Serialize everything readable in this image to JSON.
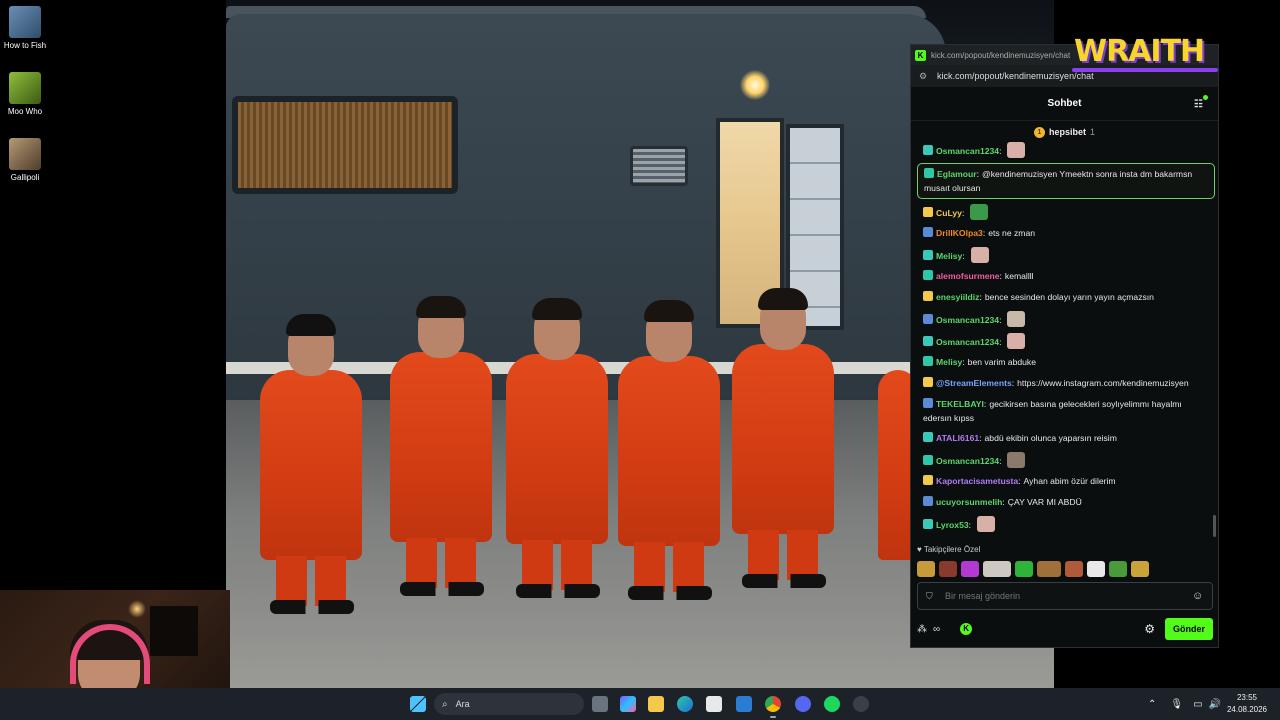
{
  "desktop": {
    "icons": [
      {
        "label": "How to Fish",
        "color": "#6a8fb5"
      },
      {
        "label": "Moo Who",
        "color": "#5a7d2a"
      },
      {
        "label": "Gallipoli",
        "color": "#8a7458"
      }
    ]
  },
  "browser": {
    "title_url": "kick.com/popout/kendinemuzisyen/chat",
    "address_url": "kick.com/popout/kendinemuzisyen/chat"
  },
  "chat": {
    "header_title": "Sohbet",
    "pinned_user": "hepsibet",
    "pinned_count": "1",
    "messages": [
      {
        "user": "Osmancan1234",
        "sep": ":",
        "text": "",
        "color": "#5cd66b"
      },
      {
        "user": "Eglamour",
        "sep": ":",
        "text": "@kendinemuzisyen Ymeektn sonra insta dm bakarmsn musaıt olursan",
        "color": "#5cd66b",
        "highlight": true
      },
      {
        "user": "CuLyy",
        "sep": ":",
        "text": "",
        "color": "#f2c94c"
      },
      {
        "user": "DrillKOlpa3",
        "sep": ":",
        "text": "ets ne zman",
        "color": "#f08a24"
      },
      {
        "user": "Melisy",
        "sep": ":",
        "text": "",
        "color": "#5cd66b"
      },
      {
        "user": "alemofsurmene",
        "sep": ":",
        "text": "kemallll",
        "color": "#f25ca8"
      },
      {
        "user": "enesyiildiz",
        "sep": ":",
        "text": "bence sesinden dolayı yarın yayın açmazsın",
        "color": "#5cd66b"
      },
      {
        "user": "Osmancan1234",
        "sep": ":",
        "text": "",
        "color": "#5cd66b"
      },
      {
        "user": "Osmancan1234",
        "sep": ":",
        "text": "",
        "color": "#5cd66b"
      },
      {
        "user": "Melisy",
        "sep": ":",
        "text": "ben varim abduke",
        "color": "#5cd66b"
      },
      {
        "user": "@StreamElements",
        "sep": ":",
        "text": "https://www.instagram.com/kendinemuzisyen",
        "color": "#7aa2ff"
      },
      {
        "user": "TEKELBAYI",
        "sep": ":",
        "text": "gecikirsen basına gelecekleri soylıyelimmı hayalmı edersın kıpss",
        "color": "#5cd66b"
      },
      {
        "user": "ATALI6161",
        "sep": ":",
        "text": "abdü ekibin olunca yaparsın reisim",
        "color": "#b07cf5"
      },
      {
        "user": "Osmancan1234",
        "sep": ":",
        "text": "",
        "color": "#5cd66b"
      },
      {
        "user": "Kaportacisametusta",
        "sep": ":",
        "text": "Ayhan abim özür dilerim",
        "color": "#b07cf5"
      },
      {
        "user": "ucuyorsunmelih",
        "sep": ":",
        "text": "ÇAY VAR MI ABDÜ",
        "color": "#5cd66b"
      },
      {
        "user": "Lyrox53",
        "sep": ":",
        "text": "",
        "color": "#5cd66b"
      }
    ],
    "emote_section_title": "Takipçilere Özel",
    "input_placeholder": "Bir mesaj gönderin",
    "send_label": "Gönder"
  },
  "overlay": {
    "logo_text": "WRAITH"
  },
  "taskbar": {
    "search_label": "Ara",
    "time": "23:55",
    "date": "24.08.2026"
  }
}
